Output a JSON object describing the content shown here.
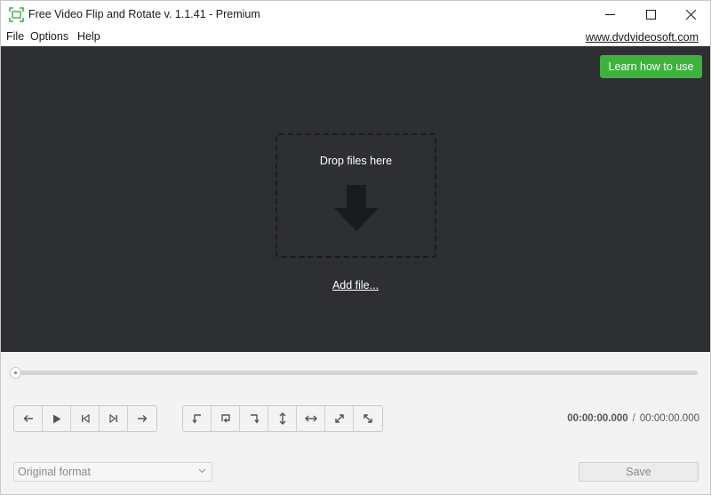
{
  "window": {
    "title": "Free Video Flip and Rotate v. 1.1.41 - Premium",
    "controls": [
      "minimize-icon",
      "maximize-icon",
      "close-icon"
    ]
  },
  "menu": {
    "items": [
      "File",
      "Options",
      "Help"
    ],
    "site_link": "www.dvdvideosoft.com"
  },
  "drop_area": {
    "learn_button": "Learn how to use",
    "drop_text": "Drop files here",
    "add_file": "Add file...",
    "arrow_icon": "arrow-down-icon"
  },
  "seek": {
    "progress": 0
  },
  "playback_buttons": [
    "arrow-left-icon",
    "play-icon",
    "skip-start-icon",
    "skip-end-icon",
    "arrow-right-icon"
  ],
  "transform_buttons": [
    "rotate-left-icon",
    "rotate-180-icon",
    "rotate-right-icon",
    "flip-vertical-icon",
    "flip-horizontal-icon",
    "transpose-icon",
    "transverse-icon"
  ],
  "time": {
    "current": "00:00:00.000",
    "separator": "/",
    "total": "00:00:00.000"
  },
  "output": {
    "format": "Original format",
    "save_label": "Save"
  },
  "colors": {
    "accent_green": "#3db33d",
    "panel_dark": "#2d2f33"
  }
}
